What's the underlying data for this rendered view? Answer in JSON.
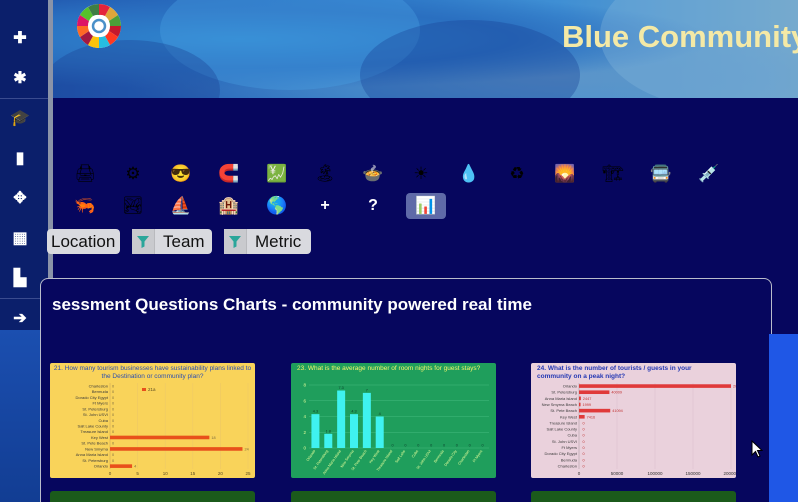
{
  "header": {
    "title": "Blue Community"
  },
  "sidebar": {
    "items": [
      {
        "icon": "plus-icon",
        "glyph": "✚"
      },
      {
        "icon": "asterisk-icon",
        "glyph": "✱"
      },
      {
        "icon": "graduation-cap-icon",
        "glyph": "🎓"
      },
      {
        "icon": "bar-chart-icon",
        "glyph": "▮"
      },
      {
        "icon": "move-icon",
        "glyph": "✥"
      },
      {
        "icon": "grid-icon",
        "glyph": "▦"
      },
      {
        "icon": "stacked-bars-icon",
        "glyph": "▙"
      },
      {
        "icon": "arrow-circle-icon",
        "glyph": "➔"
      }
    ]
  },
  "toolbar": {
    "row1": [
      {
        "icon": "printer-icon",
        "glyph": "🖨"
      },
      {
        "icon": "gear-icon",
        "glyph": "⚙"
      },
      {
        "icon": "sunglasses-icon",
        "glyph": "😎"
      },
      {
        "icon": "magnet-icon",
        "glyph": "🧲"
      },
      {
        "icon": "chart-up-icon",
        "glyph": "💹"
      },
      {
        "icon": "beach-icon",
        "glyph": "🏝"
      },
      {
        "icon": "food-bowl-icon",
        "glyph": "🍲"
      },
      {
        "icon": "sun-icon",
        "glyph": "☀"
      },
      {
        "icon": "droplet-icon",
        "glyph": "💧"
      },
      {
        "icon": "recycle-icon",
        "glyph": "♻"
      },
      {
        "icon": "sunset-icon",
        "glyph": "🌄"
      },
      {
        "icon": "crane-icon",
        "glyph": "🏗"
      },
      {
        "icon": "bus-icon",
        "glyph": "🚍"
      },
      {
        "icon": "syringe-icon",
        "glyph": "💉"
      }
    ],
    "row2": [
      {
        "icon": "shrimp-icon",
        "glyph": "🦐"
      },
      {
        "icon": "landscape-icon",
        "glyph": "🏞"
      },
      {
        "icon": "sailboat-icon",
        "glyph": "⛵"
      },
      {
        "icon": "hotel-icon",
        "glyph": "🏨"
      },
      {
        "icon": "globe-icon",
        "glyph": "🌎"
      },
      {
        "icon": "plus-text",
        "glyph": "+"
      },
      {
        "icon": "question-text",
        "glyph": "?"
      },
      {
        "icon": "bar-chart-selected-icon",
        "glyph": "📊"
      }
    ]
  },
  "filters": [
    {
      "label": "Location"
    },
    {
      "label": "Team"
    },
    {
      "label": "Metric"
    }
  ],
  "section": {
    "title": "sessment Questions Charts - community powered real time"
  },
  "chart_data": [
    {
      "type": "bar",
      "title": "21. How many tourism businesses have sustainability plans linked to the Destination or community plan?",
      "orientation": "horizontal",
      "categories": [
        "Orlando",
        "St. Petersburg",
        "Anna Maria Island",
        "New Smyrna",
        "St. Pete Beach",
        "Key West",
        "Treasure Island",
        "Salt Lake County",
        "Cuba",
        "St. John USVI",
        "St. Petersburg",
        "Ft Myers",
        "Dorado City Egypt",
        "Bermuda",
        "Charleston"
      ],
      "values": [
        4,
        0,
        0,
        24,
        0,
        18,
        0,
        0,
        0,
        0,
        0,
        0,
        0,
        0,
        0
      ],
      "xlim": [
        0,
        25
      ],
      "xticks": [
        "0",
        "5",
        "10",
        "15",
        "20",
        "25"
      ],
      "legend": "21a"
    },
    {
      "type": "bar",
      "title": "23. What is the average number of room nights for guest stays?",
      "categories": [
        "Orlando",
        "St. Petersburg",
        "Anna Maria Island",
        "New Smyrna",
        "St. Pete Beach",
        "Key West",
        "Treasure Island",
        "Salt Lake",
        "Cuba",
        "St. John USVI",
        "Bermuda",
        "Dorado City",
        "Charleston",
        "Ft Myers"
      ],
      "values": [
        4.3,
        1.8,
        7.3,
        4.3,
        7,
        4,
        0,
        0,
        0,
        0,
        0,
        0,
        0,
        0
      ],
      "ylim": [
        0,
        8
      ],
      "yticks": [
        "0",
        "2",
        "4",
        "6",
        "8"
      ]
    },
    {
      "type": "bar",
      "title": "24. What is the number of tourists / guests in your community on a peak night?",
      "orientation": "horizontal",
      "categories": [
        "Orlando",
        "St. Petersburg",
        "Anna Maria Island",
        "New Smyrna Beach",
        "St. Pete Beach",
        "Key West",
        "Treasure Island",
        "Salt Lake County",
        "Cuba",
        "St. John USVI",
        "Ft Myers",
        "Dorado City Egypt",
        "Bermuda",
        "Charleston"
      ],
      "values": [
        209478,
        40009,
        2447,
        1999,
        41094,
        7416,
        0,
        0,
        0,
        0,
        0,
        0,
        0,
        0
      ],
      "xlim": [
        0,
        200000
      ],
      "xticks": [
        "0",
        "50000",
        "100000",
        "150000",
        "200000"
      ]
    }
  ]
}
